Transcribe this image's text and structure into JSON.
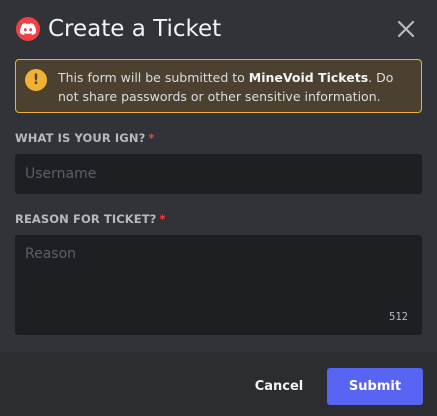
{
  "modal": {
    "title": "Create a Ticket",
    "icon": "discord-icon",
    "close_icon": "close-icon"
  },
  "warning": {
    "icon": "exclamation-icon",
    "text_before": "This form will be submitted to ",
    "app_name": "MineVoid Tickets",
    "text_after": ". Do not share passwords or other sensitive information."
  },
  "fields": [
    {
      "label": "WHAT IS YOUR IGN?",
      "required_marker": "*",
      "placeholder": "Username",
      "value": ""
    },
    {
      "label": "REASON FOR TICKET?",
      "required_marker": "*",
      "placeholder": "Reason",
      "value": "",
      "char_counter": "512"
    }
  ],
  "footer": {
    "cancel_label": "Cancel",
    "submit_label": "Submit"
  },
  "colors": {
    "background": "#313338",
    "footer": "#2b2d31",
    "input": "#1e1f22",
    "warning_border": "#f0b232",
    "warning_bg": "#4c4130",
    "required": "#f23f43",
    "brand": "#5865f2"
  }
}
